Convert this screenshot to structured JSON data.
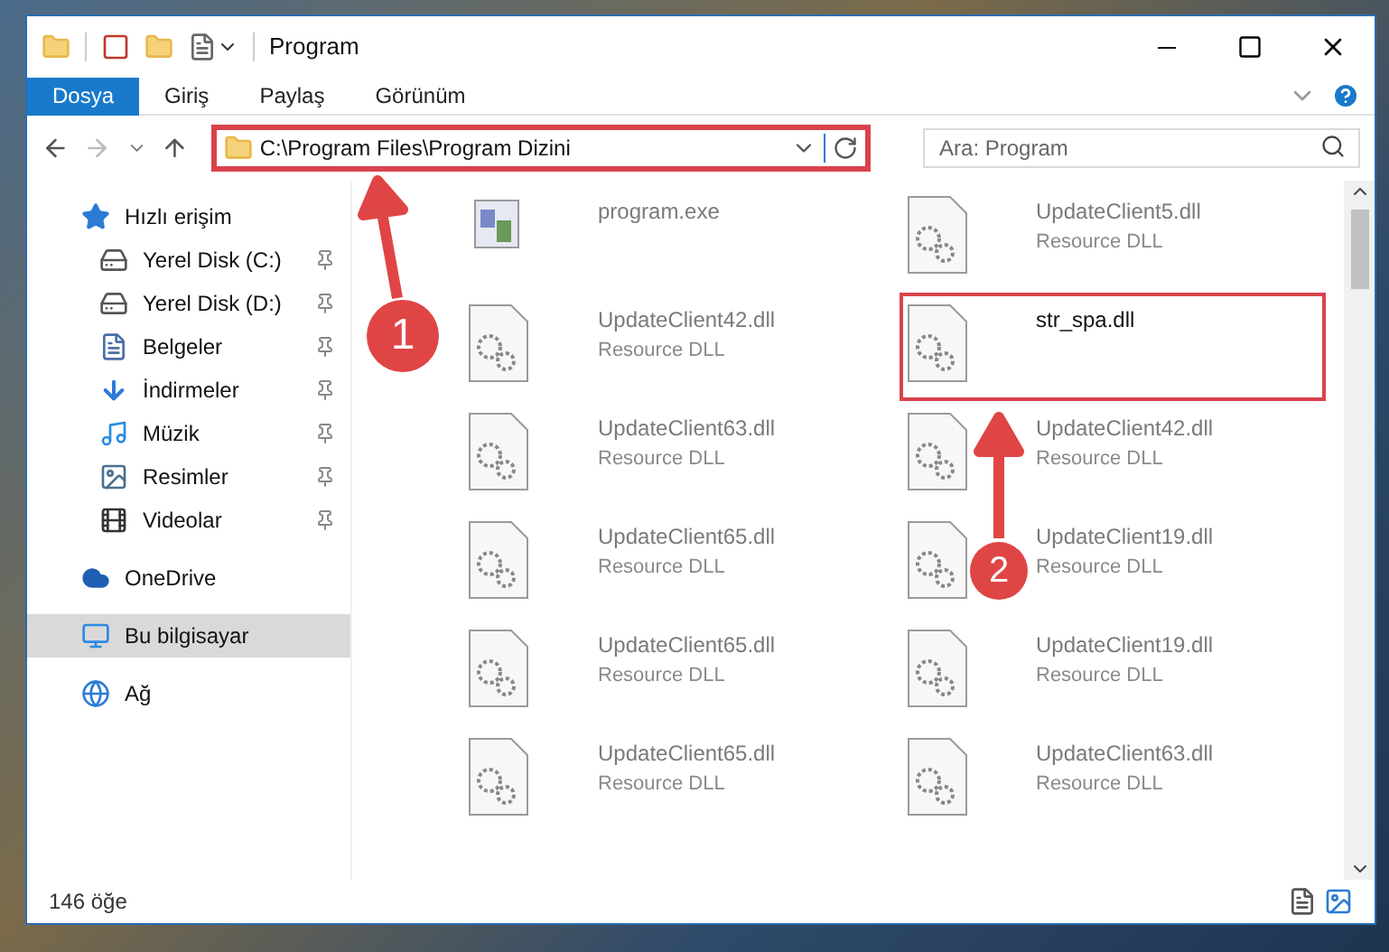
{
  "window": {
    "title": "Program"
  },
  "ribbon_tabs": [
    {
      "label": "Dosya",
      "selected": true
    },
    {
      "label": "Giriş",
      "selected": false
    },
    {
      "label": "Paylaş",
      "selected": false
    },
    {
      "label": "Görünüm",
      "selected": false
    }
  ],
  "address": {
    "path": "C:\\Program Files\\Program Dizini",
    "highlighted": true
  },
  "search": {
    "placeholder": "Ara: Program"
  },
  "sidebar": {
    "items": [
      {
        "label": "Hızlı erişim",
        "kind": "star",
        "pinned": false,
        "selected": false,
        "children": [
          {
            "label": "Yerel Disk (C:)",
            "kind": "drive-c",
            "pinned": true,
            "selected": false
          },
          {
            "label": "Yerel Disk (D:)",
            "kind": "drive",
            "pinned": true,
            "selected": false
          },
          {
            "label": "Belgeler",
            "kind": "document",
            "pinned": true,
            "selected": false
          },
          {
            "label": "İndirmeler",
            "kind": "download",
            "pinned": true,
            "selected": false
          },
          {
            "label": "Müzik",
            "kind": "music",
            "pinned": true,
            "selected": false
          },
          {
            "label": "Resimler",
            "kind": "pictures",
            "pinned": true,
            "selected": false
          },
          {
            "label": "Videolar",
            "kind": "video",
            "pinned": true,
            "selected": false
          }
        ]
      },
      {
        "label": "OneDrive",
        "kind": "cloud",
        "pinned": false,
        "selected": false
      },
      {
        "label": "Bu bilgisayar",
        "kind": "computer",
        "pinned": false,
        "selected": true
      },
      {
        "label": "Ağ",
        "kind": "network",
        "pinned": false,
        "selected": false
      }
    ]
  },
  "files": [
    {
      "name": "program.exe",
      "kind": "exe",
      "dimmed": true,
      "highlighted": false
    },
    {
      "name": "UpdateClient5.dll",
      "type": "Resource DLL",
      "kind": "dll",
      "dimmed": true,
      "highlighted": false
    },
    {
      "name": "UpdateClient42.dll",
      "type": "Resource DLL",
      "kind": "dll",
      "dimmed": true,
      "highlighted": false
    },
    {
      "name": "str_spa.dll",
      "kind": "dll",
      "dimmed": false,
      "highlighted": true
    },
    {
      "name": "UpdateClient63.dll",
      "type": "Resource DLL",
      "kind": "dll",
      "dimmed": true,
      "highlighted": false
    },
    {
      "name": "UpdateClient42.dll",
      "type": "Resource DLL",
      "kind": "dll",
      "dimmed": true,
      "highlighted": false
    },
    {
      "name": "UpdateClient65.dll",
      "type": "Resource DLL",
      "kind": "dll",
      "dimmed": true,
      "highlighted": false
    },
    {
      "name": "UpdateClient19.dll",
      "type": "Resource DLL",
      "kind": "dll",
      "dimmed": true,
      "highlighted": false
    },
    {
      "name": "UpdateClient65.dll",
      "type": "Resource DLL",
      "kind": "dll",
      "dimmed": true,
      "highlighted": false
    },
    {
      "name": "UpdateClient19.dll",
      "type": "Resource DLL",
      "kind": "dll",
      "dimmed": true,
      "highlighted": false
    },
    {
      "name": "UpdateClient65.dll",
      "type": "Resource DLL",
      "kind": "dll",
      "dimmed": true,
      "highlighted": false
    },
    {
      "name": "UpdateClient63.dll",
      "type": "Resource DLL",
      "kind": "dll",
      "dimmed": true,
      "highlighted": false
    }
  ],
  "status_bar": {
    "count": "146 öğe"
  },
  "annotations": [
    {
      "number": "1"
    },
    {
      "number": "2"
    }
  ]
}
